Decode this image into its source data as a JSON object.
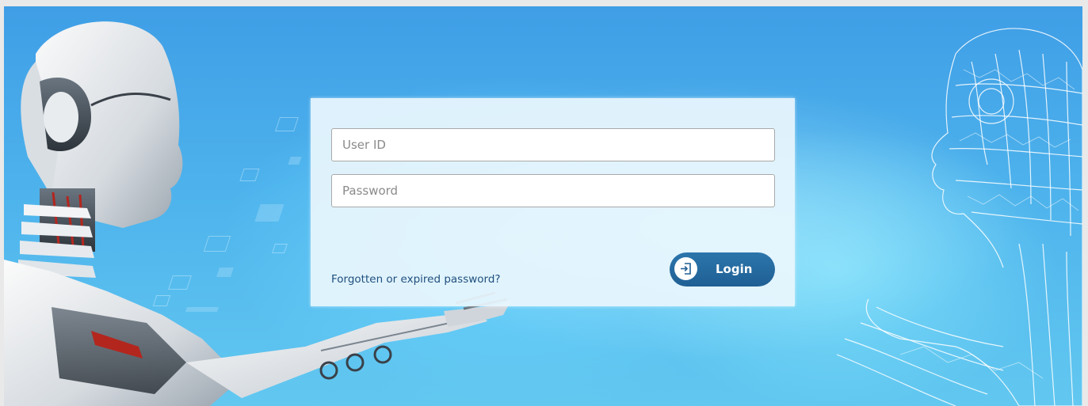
{
  "login_form": {
    "userid_placeholder": "User ID",
    "password_placeholder": "Password",
    "forgot_link_text": "Forgotten or expired password?",
    "login_button_label": "Login",
    "login_icon": "sign-in-icon"
  },
  "background": {
    "left_figure": "robot-illustration",
    "right_figure": "wireframe-human-illustration"
  },
  "colors": {
    "accent": "#1f5f94",
    "link": "#1f4f7d",
    "background_blue": "#4db2ec"
  }
}
